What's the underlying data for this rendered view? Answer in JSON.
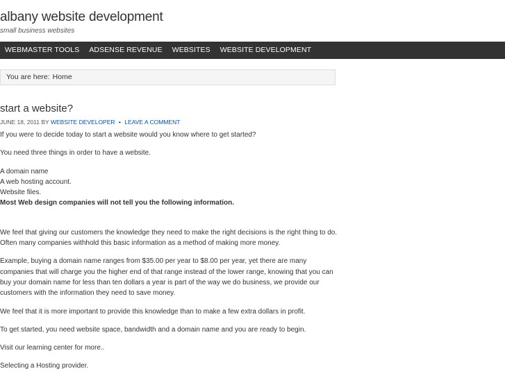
{
  "site": {
    "title": "albany website development",
    "description": "small business websites"
  },
  "nav": {
    "items": [
      {
        "label": "WEBMASTER TOOLS"
      },
      {
        "label": "ADSENSE REVENUE"
      },
      {
        "label": "WEBSITES"
      },
      {
        "label": "WEBSITE DEVELOPMENT"
      }
    ]
  },
  "breadcrumb": {
    "prefix": "You are here:",
    "current": "Home"
  },
  "post": {
    "title": "start a website?",
    "date": "JUNE 18, 2011",
    "by": "BY",
    "author": "WEBSITE DEVELOPER",
    "bullet": "•",
    "comment_link": "LEAVE A COMMENT",
    "paragraphs": {
      "p1": "If you were to decide today to start a website would you know where to get started?",
      "p2": "You need three things in order to have a website.",
      "list1": "A domain name",
      "list2": "A web hosting account.",
      "list3": "Website files.",
      "bold_line": "Most Web design companies will not tell you the following information.",
      "p3a": "We feel that giving our customers the knowledge they need to make the right decisions is the right thing to do.",
      "p3b": "Often many companies withhold this basic information as a method of making more money.",
      "p4a": "Example, buying a domain name ranges from $35.00 per year to $8.00 per year, yet there are many",
      "p4b": "companies that will charge you the higher end of that range instead of the lower range, knowing that you can",
      "p4c": "buy your domain name for less than ten dollars a year is part of the way we do business, we provide our",
      "p4d": "customers with the information they need to save money.",
      "p5": "We feel that it is more important to provide this knowledge than to make a few extra dollars in profit.",
      "p6": "To get started, you need website space, bandwidth and a domain name and you are ready to begin.",
      "p7": "Visit our learning center for more..",
      "p8": "Selecting a Hosting provider."
    }
  },
  "colors": {
    "navbar_bg": "#333333",
    "nav_text": "#ffffff",
    "link": "#0d4ea0",
    "breadcrumb_bg": "#f5f5f5"
  }
}
